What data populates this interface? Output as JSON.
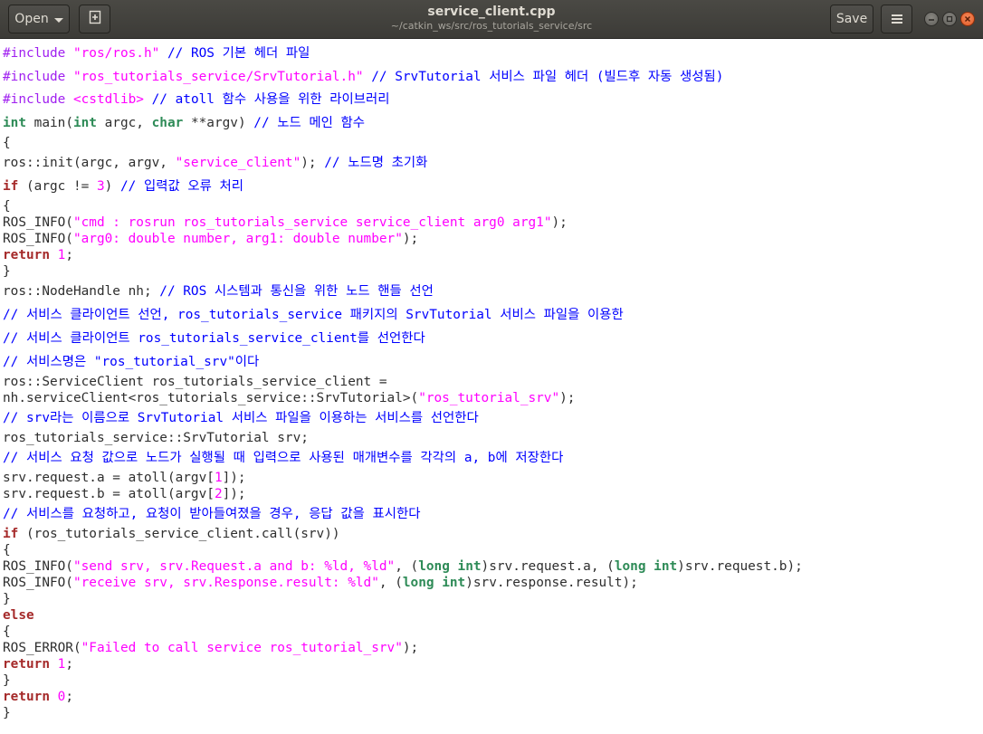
{
  "header": {
    "open_label": "Open",
    "title": "service_client.cpp",
    "subtitle": "~/catkin_ws/src/ros_tutorials_service/src",
    "save_label": "Save"
  },
  "icons": {
    "open": "chevron-down-icon",
    "new_document": "new-document-icon",
    "menu": "hamburger-menu-icon",
    "minimize": "minimize-icon",
    "maximize": "maximize-icon",
    "close": "close-icon"
  },
  "colors": {
    "titlebar": "#3c3b37",
    "close": "#e95420",
    "preprocessor": "#a020f0",
    "string": "#ff00ff",
    "comment": "#0000ff",
    "keyword": "#a52a2a",
    "type": "#2e8b57",
    "text": "#2e2e2e"
  },
  "code": {
    "lines": [
      [
        [
          "pp",
          "#include "
        ],
        [
          "str",
          "\"ros/ros.h\""
        ],
        [
          "t",
          " "
        ],
        [
          "cmt",
          "// ROS 기본 헤더 파일"
        ]
      ],
      [
        [
          "pp",
          "#include "
        ],
        [
          "str",
          "\"ros_tutorials_service/SrvTutorial.h\""
        ],
        [
          "t",
          " "
        ],
        [
          "cmt",
          "// SrvTutorial 서비스 파일 헤더 (빌드후 자동 생성됨)"
        ]
      ],
      [
        [
          "pp",
          "#include "
        ],
        [
          "str",
          "<cstdlib>"
        ],
        [
          "t",
          " "
        ],
        [
          "cmt",
          "// atoll 함수 사용을 위한 라이브러리"
        ]
      ],
      [
        [
          "ty",
          "int"
        ],
        [
          "t",
          " main("
        ],
        [
          "ty",
          "int"
        ],
        [
          "t",
          " argc, "
        ],
        [
          "ty",
          "char"
        ],
        [
          "t",
          " **argv) "
        ],
        [
          "cmt",
          "// 노드 메인 함수"
        ]
      ],
      [
        [
          "t",
          "{"
        ]
      ],
      [
        [
          "t",
          "ros::init(argc, argv, "
        ],
        [
          "str",
          "\"service_client\""
        ],
        [
          "t",
          "); "
        ],
        [
          "cmt",
          "// 노드명 초기화"
        ]
      ],
      [
        [
          "kw",
          "if"
        ],
        [
          "t",
          " (argc != "
        ],
        [
          "num",
          "3"
        ],
        [
          "t",
          ") "
        ],
        [
          "cmt",
          "// 입력값 오류 처리"
        ]
      ],
      [
        [
          "t",
          "{"
        ]
      ],
      [
        [
          "t",
          "ROS_INFO("
        ],
        [
          "str",
          "\"cmd : rosrun ros_tutorials_service service_client arg0 arg1\""
        ],
        [
          "t",
          ");"
        ]
      ],
      [
        [
          "t",
          "ROS_INFO("
        ],
        [
          "str",
          "\"arg0: double number, arg1: double number\""
        ],
        [
          "t",
          ");"
        ]
      ],
      [
        [
          "kw",
          "return"
        ],
        [
          "t",
          " "
        ],
        [
          "num",
          "1"
        ],
        [
          "t",
          ";"
        ]
      ],
      [
        [
          "t",
          "}"
        ]
      ],
      [
        [
          "t",
          "ros::NodeHandle nh; "
        ],
        [
          "cmt",
          "// ROS 시스템과 통신을 위한 노드 핸들 선언"
        ]
      ],
      [
        [
          "cmt",
          "// 서비스 클라이언트 선언, ros_tutorials_service 패키지의 SrvTutorial 서비스 파일을 이용한"
        ]
      ],
      [
        [
          "cmt",
          "// 서비스 클라이언트 ros_tutorials_service_client를 선언한다"
        ]
      ],
      [
        [
          "cmt",
          "// 서비스명은 \"ros_tutorial_srv\"이다"
        ]
      ],
      [
        [
          "t",
          "ros::ServiceClient ros_tutorials_service_client ="
        ]
      ],
      [
        [
          "t",
          "nh.serviceClient<ros_tutorials_service::SrvTutorial>("
        ],
        [
          "str",
          "\"ros_tutorial_srv\""
        ],
        [
          "t",
          ");"
        ]
      ],
      [
        [
          "cmt",
          "// srv라는 이름으로 SrvTutorial 서비스 파일을 이용하는 서비스를 선언한다"
        ]
      ],
      [
        [
          "t",
          "ros_tutorials_service::SrvTutorial srv;"
        ]
      ],
      [
        [
          "cmt",
          "// 서비스 요청 값으로 노드가 실행될 때 입력으로 사용된 매개변수를 각각의 a, b에 저장한다"
        ]
      ],
      [
        [
          "t",
          "srv.request.a = atoll(argv["
        ],
        [
          "num",
          "1"
        ],
        [
          "t",
          "]);"
        ]
      ],
      [
        [
          "t",
          "srv.request.b = atoll(argv["
        ],
        [
          "num",
          "2"
        ],
        [
          "t",
          "]);"
        ]
      ],
      [
        [
          "cmt",
          "// 서비스를 요청하고, 요청이 받아들여졌을 경우, 응답 값을 표시한다"
        ]
      ],
      [
        [
          "kw",
          "if"
        ],
        [
          "t",
          " (ros_tutorials_service_client.call(srv))"
        ]
      ],
      [
        [
          "t",
          "{"
        ]
      ],
      [
        [
          "t",
          "ROS_INFO("
        ],
        [
          "str",
          "\"send srv, srv.Request.a and b: %ld, %ld\""
        ],
        [
          "t",
          ", ("
        ],
        [
          "ty",
          "long"
        ],
        [
          "t",
          " "
        ],
        [
          "ty",
          "int"
        ],
        [
          "t",
          ")srv.request.a, ("
        ],
        [
          "ty",
          "long"
        ],
        [
          "t",
          " "
        ],
        [
          "ty",
          "int"
        ],
        [
          "t",
          ")srv.request.b);"
        ]
      ],
      [
        [
          "t",
          "ROS_INFO("
        ],
        [
          "str",
          "\"receive srv, srv.Response.result: %ld\""
        ],
        [
          "t",
          ", ("
        ],
        [
          "ty",
          "long"
        ],
        [
          "t",
          " "
        ],
        [
          "ty",
          "int"
        ],
        [
          "t",
          ")srv.response.result);"
        ]
      ],
      [
        [
          "t",
          "}"
        ]
      ],
      [
        [
          "kw",
          "else"
        ]
      ],
      [
        [
          "t",
          "{"
        ]
      ],
      [
        [
          "t",
          "ROS_ERROR("
        ],
        [
          "str",
          "\"Failed to call service ros_tutorial_srv\""
        ],
        [
          "t",
          ");"
        ]
      ],
      [
        [
          "kw",
          "return"
        ],
        [
          "t",
          " "
        ],
        [
          "num",
          "1"
        ],
        [
          "t",
          ";"
        ]
      ],
      [
        [
          "t",
          "}"
        ]
      ],
      [
        [
          "kw",
          "return"
        ],
        [
          "t",
          " "
        ],
        [
          "num",
          "0"
        ],
        [
          "t",
          ";"
        ]
      ],
      [
        [
          "t",
          "}"
        ]
      ]
    ]
  }
}
